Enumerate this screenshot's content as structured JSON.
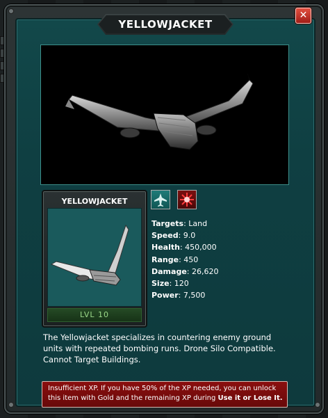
{
  "dialog": {
    "title": "YELLOWJACKET",
    "close_label": "✕"
  },
  "unit_card": {
    "name": "YELLOWJACKET",
    "level_label": "LVL 10"
  },
  "badges": [
    {
      "icon": "land-jet-icon",
      "color": "#1f7b78"
    },
    {
      "icon": "bomb-burst-icon",
      "color": "#7a1010"
    }
  ],
  "stats": [
    {
      "label": "Targets",
      "value": "Land"
    },
    {
      "label": "Speed",
      "value": "9.0"
    },
    {
      "label": "Health",
      "value": "450,000"
    },
    {
      "label": "Range",
      "value": "450"
    },
    {
      "label": "Damage",
      "value": "26,620"
    },
    {
      "label": "Size",
      "value": "120"
    },
    {
      "label": "Power",
      "value": "7,500"
    }
  ],
  "description": "The Yellowjacket specializes in countering enemy ground units with repeated bombing runs. Drone Silo Compatible. Cannot Target Buildings.",
  "warning": {
    "text": "Insufficient XP. If you have 50% of the XP needed, you can unlock this item with Gold and the remaining XP during ",
    "emphasis": "Use it or Lose It."
  },
  "colors": {
    "panel": "#0f3f42",
    "accent_border": "#3c8f8a",
    "warning_bg": "#7a0d0d",
    "close_button": "#c0392b",
    "level_text": "#9bd889"
  }
}
